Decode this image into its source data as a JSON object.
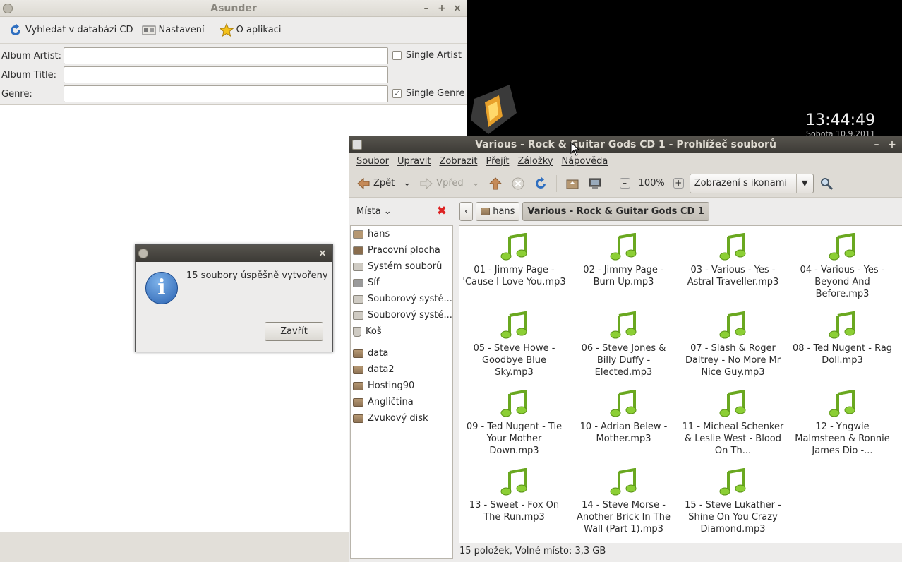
{
  "desktop": {
    "time": "13:44:49",
    "date": "Sobota 10.9.2011"
  },
  "asunder": {
    "title": "Asunder",
    "window_buttons": [
      "–",
      "+",
      "×"
    ],
    "toolbar": {
      "lookup": "Vyhledat v databázi CD",
      "settings": "Nastavení",
      "about": "O aplikaci"
    },
    "fields": {
      "album_artist_label": "Album Artist:",
      "album_title_label": "Album Title:",
      "genre_label": "Genre:",
      "album_artist_value": "",
      "album_title_value": "",
      "genre_value": ""
    },
    "single_artist": {
      "label": "Single Artist",
      "checked": false
    },
    "single_genre": {
      "label": "Single Genre",
      "checked": true
    }
  },
  "dialog": {
    "message": "15 soubory úspěšně vytvořeny",
    "close": "Zavřít",
    "icon": "info-icon"
  },
  "nautilus": {
    "title": "Various - Rock & Guitar Gods CD 1 - Prohlížeč souborů",
    "menu": [
      "Soubor",
      "Upravit",
      "Zobrazit",
      "Přejít",
      "Záložky",
      "Nápověda"
    ],
    "toolbar": {
      "back": "Zpět",
      "forward": "Vpřed",
      "zoom": "100%",
      "view_mode": "Zobrazení s ikonami"
    },
    "sidebar_title": "Místa",
    "places": [
      {
        "label": "hans",
        "icon": "home-icon"
      },
      {
        "label": "Pracovní plocha",
        "icon": "desktop-icon"
      },
      {
        "label": "Systém souborů",
        "icon": "drive-icon"
      },
      {
        "label": "Síť",
        "icon": "network-icon"
      },
      {
        "label": "Souborový systé...",
        "icon": "drive-icon"
      },
      {
        "label": "Souborový systé...",
        "icon": "drive-icon"
      },
      {
        "label": "Koš",
        "icon": "trash-icon"
      }
    ],
    "bookmarks": [
      "data",
      "data2",
      "Hosting90",
      "Angličtina",
      "Zvukový disk"
    ],
    "path": {
      "home": "hans",
      "current": "Various - Rock & Guitar Gods CD 1"
    },
    "files": [
      "01 - Jimmy Page - 'Cause I Love You.mp3",
      "02 - Jimmy Page - Burn Up.mp3",
      "03 - Various - Yes - Astral Traveller.mp3",
      "04 - Various - Yes - Beyond And Before.mp3",
      "05 - Steve Howe - Goodbye Blue Sky.mp3",
      "06 - Steve Jones & Billy Duffy - Elected.mp3",
      "07 - Slash & Roger Daltrey - No More Mr Nice Guy.mp3",
      "08 - Ted Nugent - Rag Doll.mp3",
      "09 - Ted Nugent - Tie Your Mother Down.mp3",
      "10 - Adrian Belew - Mother.mp3",
      "11 - Micheal Schenker & Leslie West - Blood On Th...",
      "12 - Yngwie Malmsteen & Ronnie James Dio -...",
      "13 - Sweet - Fox On The Run.mp3",
      "14 - Steve Morse - Another Brick In The Wall (Part 1).mp3",
      "15 - Steve Lukather - Shine On You Crazy Diamond.mp3"
    ],
    "status": "15 položek, Volné místo: 3,3 GB"
  }
}
